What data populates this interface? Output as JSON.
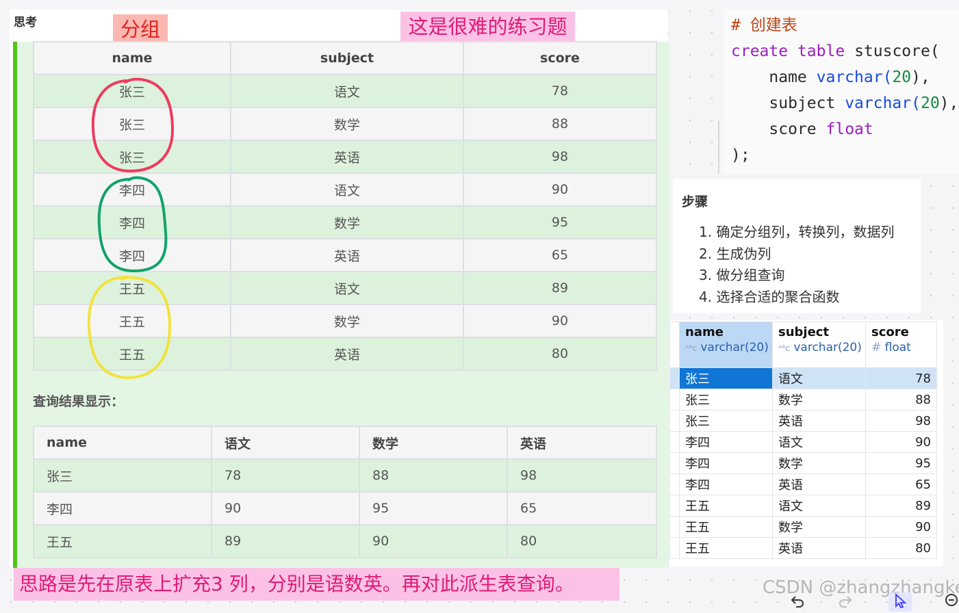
{
  "left_panel": {
    "title": "思考",
    "group_label": "分组",
    "hard_label": "这是很难的练习题",
    "source_table": {
      "headers": [
        "name",
        "subject",
        "score"
      ],
      "rows": [
        [
          "张三",
          "语文",
          "78"
        ],
        [
          "张三",
          "数学",
          "88"
        ],
        [
          "张三",
          "英语",
          "98"
        ],
        [
          "李四",
          "语文",
          "90"
        ],
        [
          "李四",
          "数学",
          "95"
        ],
        [
          "李四",
          "英语",
          "65"
        ],
        [
          "王五",
          "语文",
          "89"
        ],
        [
          "王五",
          "数学",
          "90"
        ],
        [
          "王五",
          "英语",
          "80"
        ]
      ]
    },
    "result_caption": "查询结果显示：",
    "result_table": {
      "headers": [
        "name",
        "语文",
        "数学",
        "英语"
      ],
      "rows": [
        [
          "张三",
          "78",
          "88",
          "98"
        ],
        [
          "李四",
          "90",
          "95",
          "65"
        ],
        [
          "王五",
          "89",
          "90",
          "80"
        ]
      ]
    },
    "group_circle_colors": [
      "#ee3b5e",
      "#12a36a",
      "#f1e33c"
    ],
    "idea_note": "思路是先在原表上扩充3 列，分别是语数英。再对此派生表查询。"
  },
  "code": {
    "comment": "# 创建表",
    "kw_create": "create",
    "kw_table": "table",
    "table_name": "stuscore(",
    "col1": "name",
    "col1_type": "varchar(",
    "col1_len": "20",
    "col1_end": "),",
    "col2": "subject",
    "col2_type": "varchar(",
    "col2_len": "20",
    "col2_end": "),",
    "col3": "score",
    "col3_type": "float",
    "close": ");"
  },
  "steps": {
    "title": "步骤",
    "items": [
      "1. 确定分组列，转换列，数据列",
      "2. 生成伪列",
      "3. 做分组查询",
      "4. 选择合适的聚合函数"
    ]
  },
  "db_grid": {
    "columns": [
      {
        "name": "name",
        "type": "varchar(20)",
        "type_icon": "ᴬᴮc"
      },
      {
        "name": "subject",
        "type": "varchar(20)",
        "type_icon": "ᴬᴮc"
      },
      {
        "name": "score",
        "type": "float",
        "type_icon": "#"
      }
    ],
    "rows": [
      [
        "张三",
        "语文",
        "78"
      ],
      [
        "张三",
        "数学",
        "88"
      ],
      [
        "张三",
        "英语",
        "98"
      ],
      [
        "李四",
        "语文",
        "90"
      ],
      [
        "李四",
        "数学",
        "95"
      ],
      [
        "李四",
        "英语",
        "65"
      ],
      [
        "王五",
        "语文",
        "89"
      ],
      [
        "王五",
        "数学",
        "90"
      ],
      [
        "王五",
        "英语",
        "80"
      ]
    ],
    "selected_row": 0
  },
  "watermark": "CSDN @zhangzhangkeji",
  "toolbar": {
    "undo_icon": "undo-icon",
    "redo_icon": "redo-icon",
    "pointer_icon": "pointer-icon",
    "zoom_out_icon": "zoom-out-icon"
  }
}
